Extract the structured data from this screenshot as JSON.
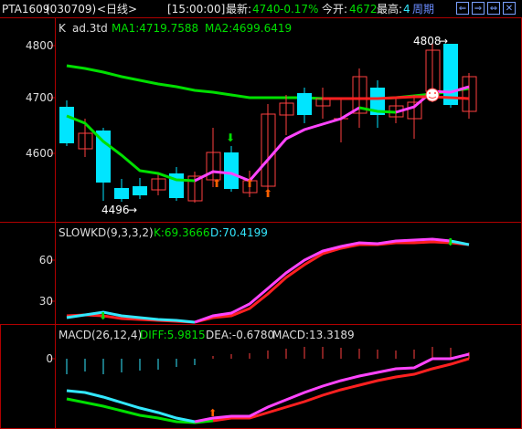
{
  "topbar": {
    "symbol": "PTA1609",
    "code": "(030709)",
    "period_label": "<日线>",
    "time": "[15:00:00]",
    "latest_label": "最新:",
    "latest_value": "4740",
    "change_pct": "-0.17%",
    "open_label": "今开:",
    "open_value": "4672",
    "high_label": "最高:",
    "high_value": "4",
    "cycle_label": "周期",
    "buttons": [
      "⇐",
      "⇒",
      "⇔",
      "✕"
    ]
  },
  "main_panel": {
    "title_k": "K",
    "title_name": "ad.3td",
    "ma1": "MA1:4719.7588",
    "ma2": "MA2:4699.6419",
    "y_labels": [
      "4800",
      "4700",
      "4600"
    ],
    "high_annotation": "4808",
    "low_annotation": "4496"
  },
  "kd_panel": {
    "title": "SLOWKD(9,3,3,2)",
    "k_value": "K:69.3666",
    "d_value": "D:70.4199",
    "y_labels": [
      "60",
      "30"
    ]
  },
  "macd_panel": {
    "title": "MACD(26,12,4)",
    "diff": "DIFF:5.9815",
    "dea": "DEA:-0.6780",
    "macd": "MACD:13.3189",
    "y_labels": [
      "0"
    ]
  },
  "colors": {
    "up_candle": "#00e5ff",
    "down_candle": "#ff4040",
    "ma1": "#ff44ff",
    "ma2": "#00e000",
    "frame": "#c00000"
  }
}
